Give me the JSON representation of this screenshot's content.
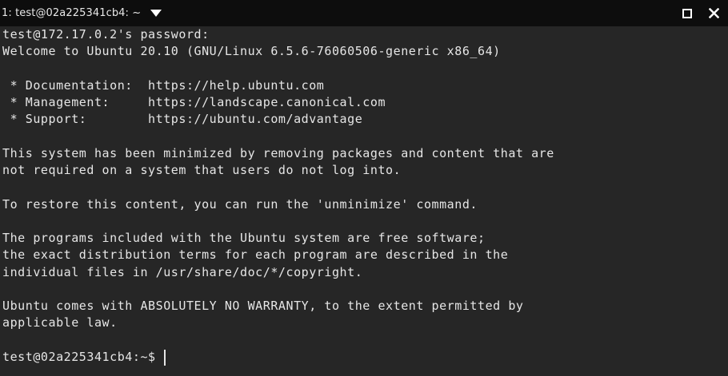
{
  "window": {
    "title": "1: test@02a225341cb4: ~"
  },
  "terminal": {
    "lines": [
      "test@172.17.0.2's password:",
      "Welcome to Ubuntu 20.10 (GNU/Linux 6.5.6-76060506-generic x86_64)",
      "",
      " * Documentation:  https://help.ubuntu.com",
      " * Management:     https://landscape.canonical.com",
      " * Support:        https://ubuntu.com/advantage",
      "",
      "This system has been minimized by removing packages and content that are",
      "not required on a system that users do not log into.",
      "",
      "To restore this content, you can run the 'unminimize' command.",
      "",
      "The programs included with the Ubuntu system are free software;",
      "the exact distribution terms for each program are described in the",
      "individual files in /usr/share/doc/*/copyright.",
      "",
      "Ubuntu comes with ABSOLUTELY NO WARRANTY, to the extent permitted by",
      "applicable law.",
      ""
    ],
    "prompt": "test@02a225341cb4:~$"
  }
}
